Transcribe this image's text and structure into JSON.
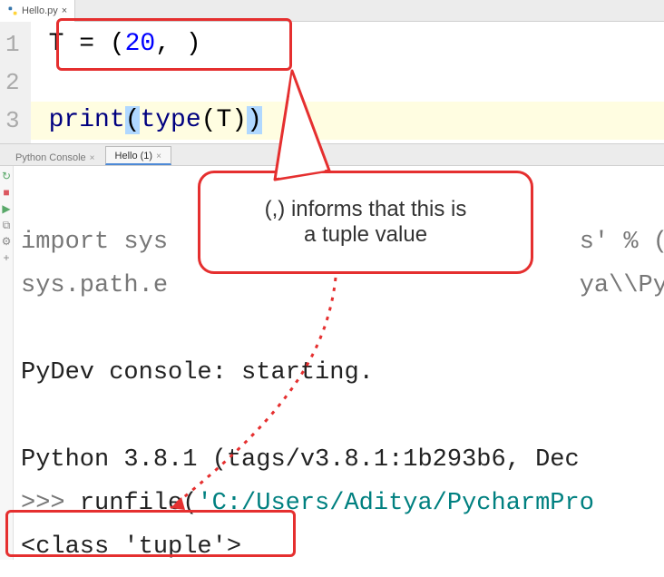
{
  "editor": {
    "tab_label": "Hello.py",
    "lines": {
      "n1": "1",
      "n2": "2",
      "n3": "3"
    },
    "code": {
      "line1_pre": "T = (",
      "line1_num": "20",
      "line1_post": ", )",
      "line3_fn": "print",
      "line3_open": "(",
      "line3_type": "type",
      "line3_arg_open": "(",
      "line3_arg": "T",
      "line3_arg_close": ")",
      "line3_close": ")"
    }
  },
  "console": {
    "tabs": {
      "t1": "Python Console",
      "t2": "Hello (1)"
    },
    "output": {
      "l1a": "import sys",
      "l1b": "s' % (s",
      "l2a": "sys.path.e",
      "l2b": "ya\\\\Py",
      "blank": " ",
      "l3": "PyDev console: starting.",
      "l4": "Python 3.8.1 (tags/v3.8.1:1b293b6, Dec ",
      "l5p": ">>> ",
      "l5f": "runfile(",
      "l5s": "'C:/Users/Aditya/PycharmPro",
      "l6": "<class 'tuple'>"
    }
  },
  "annotation": {
    "callout_line1": "(,) informs that this is",
    "callout_line2": "a tuple value"
  }
}
